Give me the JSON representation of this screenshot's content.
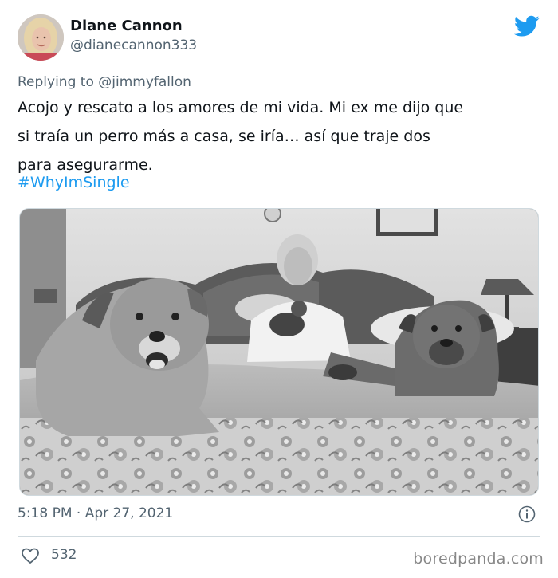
{
  "author": {
    "name": "Diane Cannon",
    "handle": "@dianecannon333"
  },
  "reply": {
    "prefix": "Replying to",
    "mention": "@jimmyfallon"
  },
  "tweet": {
    "lines": [
      "Acojo y rescato a los amores de mi vida. Mi ex me dijo que",
      "si traía un perro más a casa, se iría… así que traje dos",
      "para asegurarme."
    ],
    "hashtag": "#WhyImSingle"
  },
  "meta": {
    "timestamp": "5:18 PM · Apr 27, 2021"
  },
  "engagement": {
    "likes": "532"
  },
  "watermark": "boredpanda.com",
  "colors": {
    "link": "#1d9bf0",
    "secondary_text": "#536471",
    "primary_text": "#0f1419"
  },
  "icons": {
    "platform": "twitter-bird-icon",
    "info": "info-icon",
    "like": "heart-icon"
  }
}
